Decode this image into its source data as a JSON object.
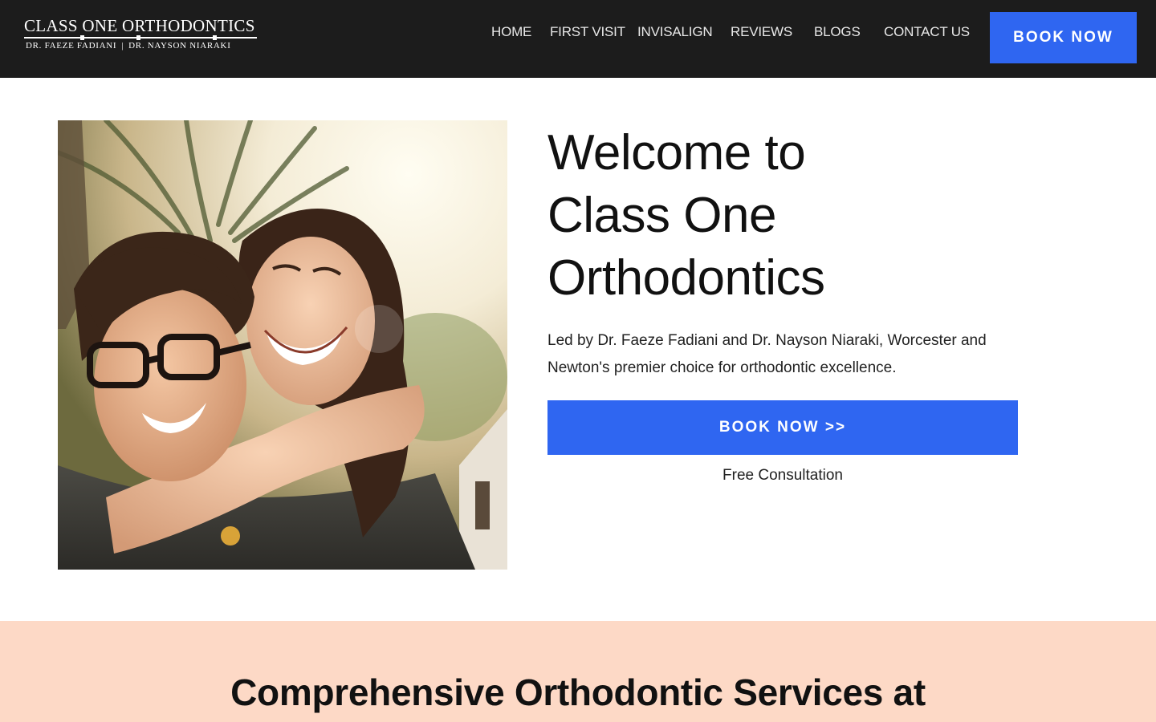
{
  "header": {
    "logo_title": "CLASS ONE ORTHODONTICS",
    "logo_doctor_1": "DR. FAEZE FADIANI",
    "logo_separator": "|",
    "logo_doctor_2": "DR. NAYSON NIARAKI",
    "nav": [
      {
        "label": "HOME"
      },
      {
        "label": "FIRST VISIT"
      },
      {
        "label": "INVISALIGN"
      },
      {
        "label": "REVIEWS"
      },
      {
        "label": "BLOGS"
      },
      {
        "label": "CONTACT US"
      }
    ],
    "book_label": "BOOK NOW"
  },
  "hero": {
    "title_lines": [
      "Welcome to",
      "Class One",
      "Orthodontics"
    ],
    "description": "Led by Dr. Faeze Fadiani and Dr. Nayson Niaraki, Worcester and Newton's premier choice for orthodontic excellence.",
    "book_label": "BOOK NOW >>",
    "note": "Free Consultation"
  },
  "services": {
    "title": "Comprehensive Orthodontic Services at"
  },
  "colors": {
    "header_bg": "#1c1c1c",
    "accent_blue": "#2f66f1",
    "services_bg": "#fdd9c6"
  }
}
